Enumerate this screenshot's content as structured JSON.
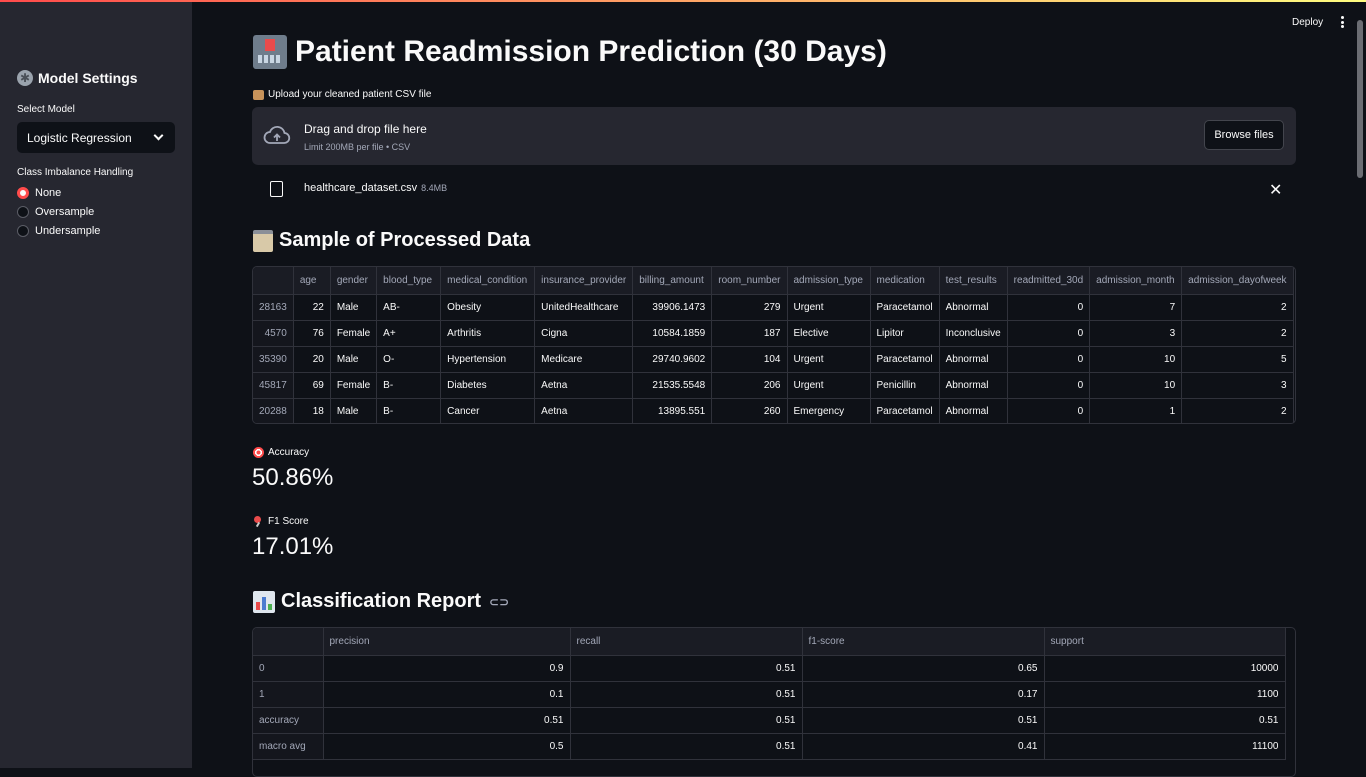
{
  "sidebar": {
    "title": "Model Settings",
    "select_model_label": "Select Model",
    "select_model_value": "Logistic Regression",
    "imbalance_label": "Class Imbalance Handling",
    "imbalance_options": [
      "None",
      "Oversample",
      "Undersample"
    ],
    "imbalance_selected": "None"
  },
  "header": {
    "deploy_label": "Deploy"
  },
  "main": {
    "title": "Patient Readmission Prediction (30 Days)",
    "upload_label": "Upload your cleaned patient CSV file",
    "dropzone": {
      "main_text": "Drag and drop file here",
      "sub_text": "Limit 200MB per file • CSV",
      "browse_label": "Browse files"
    },
    "uploaded_file": {
      "name": "healthcare_dataset.csv",
      "size": "8.4MB"
    },
    "sample_title": "Sample of Processed Data",
    "sample_table": {
      "columns": [
        "",
        "age",
        "gender",
        "blood_type",
        "medical_condition",
        "insurance_provider",
        "billing_amount",
        "room_number",
        "admission_type",
        "medication",
        "test_results",
        "readmitted_30d",
        "admission_month",
        "admission_dayofweek"
      ],
      "rows": [
        [
          "28163",
          "22",
          "Male",
          "AB-",
          "Obesity",
          "UnitedHealthcare",
          "39906.1473",
          "279",
          "Urgent",
          "Paracetamol",
          "Abnormal",
          "0",
          "7",
          "2"
        ],
        [
          "4570",
          "76",
          "Female",
          "A+",
          "Arthritis",
          "Cigna",
          "10584.1859",
          "187",
          "Elective",
          "Lipitor",
          "Inconclusive",
          "0",
          "3",
          "2"
        ],
        [
          "35390",
          "20",
          "Male",
          "O-",
          "Hypertension",
          "Medicare",
          "29740.9602",
          "104",
          "Urgent",
          "Paracetamol",
          "Abnormal",
          "0",
          "10",
          "5"
        ],
        [
          "45817",
          "69",
          "Female",
          "B-",
          "Diabetes",
          "Aetna",
          "21535.5548",
          "206",
          "Urgent",
          "Penicillin",
          "Abnormal",
          "0",
          "10",
          "3"
        ],
        [
          "20288",
          "18",
          "Male",
          "B-",
          "Cancer",
          "Aetna",
          "13895.551",
          "260",
          "Emergency",
          "Paracetamol",
          "Abnormal",
          "0",
          "1",
          "2"
        ]
      ]
    },
    "accuracy_label": "Accuracy",
    "accuracy_value": "50.86%",
    "f1_label": "F1 Score",
    "f1_value": "17.01%",
    "report_title": "Classification Report",
    "report_table": {
      "columns": [
        "",
        "precision",
        "recall",
        "f1-score",
        "support"
      ],
      "rows": [
        [
          "0",
          "0.9",
          "0.51",
          "0.65",
          "10000"
        ],
        [
          "1",
          "0.1",
          "0.51",
          "0.17",
          "1100"
        ],
        [
          "accuracy",
          "0.51",
          "0.51",
          "0.51",
          "0.51"
        ],
        [
          "macro avg",
          "0.5",
          "0.51",
          "0.41",
          "11100"
        ]
      ]
    }
  }
}
